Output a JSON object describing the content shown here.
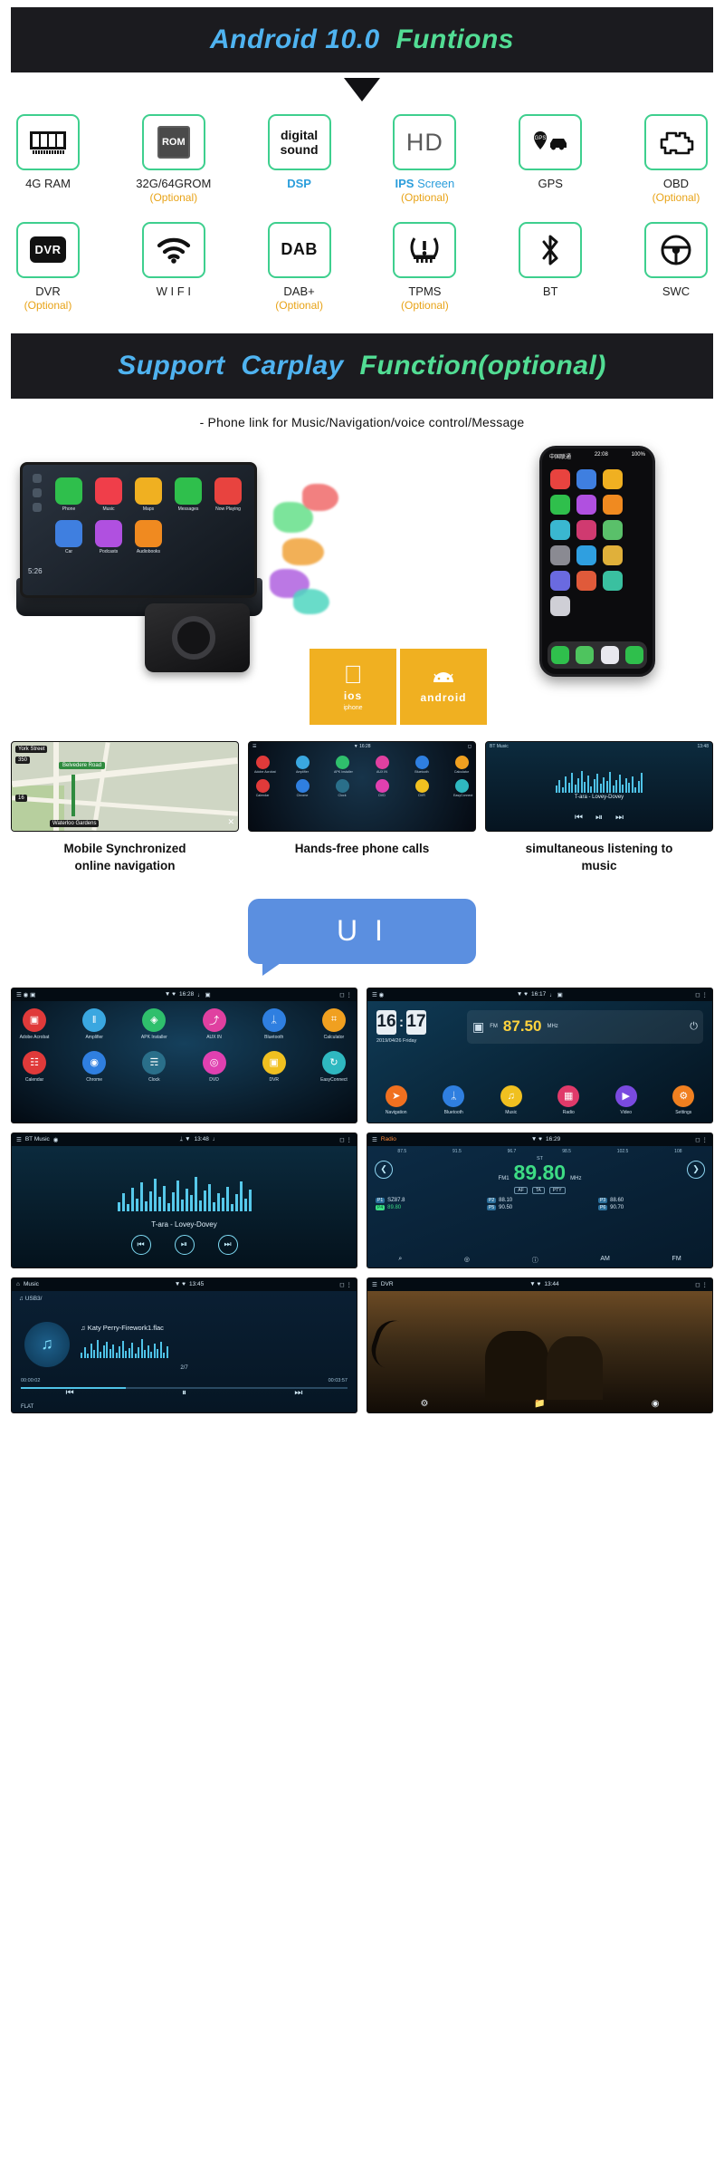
{
  "banners": {
    "android": {
      "blue": "Android 10.0",
      "green": "  Funtions"
    },
    "carplay": {
      "blue": "Support  Carplay  ",
      "green": "Function(optional)"
    }
  },
  "features_row1": [
    {
      "icon": "ram-module-icon",
      "label": "4G RAM",
      "optional": ""
    },
    {
      "icon": "rom-chip-icon",
      "label": "32G/64GROM",
      "optional": "(Optional)"
    },
    {
      "icon": "digital-sound-icon",
      "icon_text": "digital\nsound",
      "label": "DSP",
      "label_style": "blue-bold",
      "optional": ""
    },
    {
      "icon": "hd-icon",
      "icon_text": "HD",
      "label_pre": "IPS",
      "label": " Screen",
      "label_style": "blue",
      "optional": "(Optional)"
    },
    {
      "icon": "gps-car-icon",
      "label": "GPS",
      "optional": ""
    },
    {
      "icon": "obd-engine-icon",
      "label": "OBD",
      "optional": "(Optional)"
    }
  ],
  "features_row2": [
    {
      "icon": "dvr-icon",
      "icon_text": "DVR",
      "label": "DVR",
      "optional": "(Optional)"
    },
    {
      "icon": "wifi-icon",
      "label": "W I F I",
      "optional": ""
    },
    {
      "icon": "dab-icon",
      "icon_text": "DAB",
      "label": "DAB+",
      "optional": "(Optional)"
    },
    {
      "icon": "tpms-icon",
      "label": "TPMS",
      "optional": "(Optional)"
    },
    {
      "icon": "bluetooth-icon",
      "label": "BT",
      "optional": ""
    },
    {
      "icon": "steering-wheel-icon",
      "label": "SWC",
      "optional": ""
    }
  ],
  "carplay_subtitle": "-  Phone   link   for   Music/Navigation/voice   control/Message",
  "carplay_apps": [
    {
      "name": "Phone",
      "color": "#2fbf4c"
    },
    {
      "name": "Music",
      "color": "#f03e4a"
    },
    {
      "name": "Maps",
      "color": "#f0b021"
    },
    {
      "name": "Messages",
      "color": "#2fbf4c"
    },
    {
      "name": "Now Playing",
      "color": "#e8433f"
    },
    {
      "name": "Car",
      "color": "#3f7fe0"
    },
    {
      "name": "Podcasts",
      "color": "#b050e0"
    },
    {
      "name": "Audiobooks",
      "color": "#f08a20"
    }
  ],
  "carplay_time": "5:26",
  "phone_status": {
    "left": "中国联通",
    "time": "22:08",
    "right": "100%"
  },
  "badges": [
    {
      "name": "ios-badge",
      "icon": "apple-icon",
      "title": "ios",
      "sub": "iphone"
    },
    {
      "name": "android-badge",
      "icon": "android-icon",
      "title": "android",
      "sub": ""
    }
  ],
  "three_shots": [
    {
      "name": "navigation-shot",
      "caption": "Mobile  Synchronized\nonline  navigation",
      "labels": [
        "350",
        "16",
        "Waterloo Gardens",
        "York Street",
        "Belvedere Road"
      ]
    },
    {
      "name": "apps-shot",
      "caption": "Hands-free  phone calls",
      "apps_row1": [
        "Adobe Acrobat",
        "Amplifier",
        "APK Installer",
        "AUX IN",
        "Bluetooth",
        "Calculator"
      ],
      "apps_row2": [
        "Calendar",
        "Chrome",
        "Clock",
        "DVD",
        "DVR",
        "EasyConnect"
      ]
    },
    {
      "name": "music-shot",
      "caption": "simultaneous listening to\nmusic",
      "status": "BT Music",
      "time": "13:48",
      "track": "T-ara - Lovey-Dovey"
    }
  ],
  "ui_bubble": "U I",
  "ui_grid": [
    {
      "name": "app-launcher-screen",
      "status_time": "16:28",
      "row1": [
        {
          "label": "Adobe Acrobat",
          "color": "#e03a3a",
          "glyph": "⬟"
        },
        {
          "label": "Amplifier",
          "color": "#3aa7e0",
          "glyph": "‖"
        },
        {
          "label": "APK Installer",
          "color": "#2fbf6c",
          "glyph": "◈"
        },
        {
          "label": "AUX IN",
          "color": "#e040a0",
          "glyph": "⤴"
        },
        {
          "label": "Bluetooth",
          "color": "#2f7fe0",
          "glyph": "ᛦ"
        },
        {
          "label": "Calculator",
          "color": "#f0a020",
          "glyph": "⌗"
        }
      ],
      "row2": [
        {
          "label": "Calendar",
          "color": "#e03a3a",
          "glyph": "☷"
        },
        {
          "label": "Chrome",
          "color": "#2f7fe0",
          "glyph": "◉"
        },
        {
          "label": "Clock",
          "color": "#2a6f8a",
          "glyph": "◴"
        },
        {
          "label": "DVD",
          "color": "#e040b0",
          "glyph": "◎"
        },
        {
          "label": "DVR",
          "color": "#f0c020",
          "glyph": "▣"
        },
        {
          "label": "EasyConnect",
          "color": "#2fb8c0",
          "glyph": "↻"
        }
      ]
    },
    {
      "name": "home-screen",
      "status_time": "16:17",
      "clock": {
        "h": "16",
        "m": "17",
        "date": "2019/04/26  Friday"
      },
      "radio_widget": {
        "band": "FM",
        "freq": "87.50",
        "unit": "MHz"
      },
      "shortcuts": [
        {
          "label": "Navigation",
          "color": "#f07020",
          "glyph": "➤"
        },
        {
          "label": "Bluetooth",
          "color": "#2f7fe0",
          "glyph": "ᛦ"
        },
        {
          "label": "Music",
          "color": "#f0c020",
          "glyph": "♫"
        },
        {
          "label": "Radio",
          "color": "#e03a6a",
          "glyph": "▦"
        },
        {
          "label": "Video",
          "color": "#7a4ae0",
          "glyph": "▶"
        },
        {
          "label": "Settings",
          "color": "#f08020",
          "glyph": "⚙"
        }
      ]
    },
    {
      "name": "bt-music-screen",
      "status_title": "BT Music",
      "status_time": "13:48",
      "track": "T-ara - Lovey-Dovey",
      "controls": [
        "⏮",
        "⏯",
        "⏭"
      ]
    },
    {
      "name": "radio-screen",
      "status_title": "Radio",
      "status_time": "16:29",
      "scale": [
        "87.5",
        "91.5",
        "96.7",
        "98.5",
        "102.5",
        "108"
      ],
      "station_label": "ST",
      "band": "FM1",
      "freq": "89.80",
      "unit": "MHz",
      "tags": [
        "AF",
        "TA",
        "PTY"
      ],
      "presets": [
        {
          "n": "P1",
          "v": "SZ87.8",
          "active": false
        },
        {
          "n": "P2",
          "v": "88.10",
          "active": false
        },
        {
          "n": "P3",
          "v": "88.60",
          "active": false
        },
        {
          "n": "P4",
          "v": "89.80",
          "active": true
        },
        {
          "n": "P5",
          "v": "90.50",
          "active": false
        },
        {
          "n": "P6",
          "v": "90.70",
          "active": false
        }
      ],
      "bottom": [
        "⌕",
        "◎",
        "ⓘ",
        "AM",
        "FM"
      ]
    },
    {
      "name": "usb-music-screen",
      "status_title": "Music",
      "status_time": "13:45",
      "source": "USB3/",
      "track": "Katy Perry-Firework1.flac",
      "count": "2/7",
      "time_elapsed": "00:00:02",
      "time_total": "00:03:57",
      "eq_mode": "FLAT",
      "controls": [
        "⏮",
        "⏸",
        "⏭"
      ]
    },
    {
      "name": "dvr-screen",
      "status_title": "DVR",
      "status_time": "13:44",
      "bottom_icons": [
        "gear-icon",
        "folder-icon",
        "camera-icon"
      ]
    }
  ]
}
